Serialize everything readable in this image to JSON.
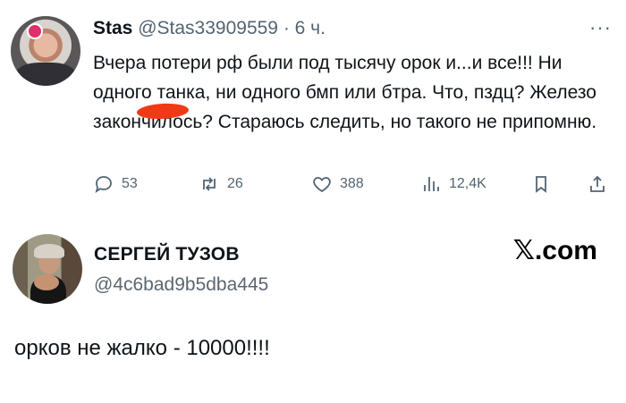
{
  "tweet": {
    "author_name": "Stas",
    "handle": "@Stas33909559",
    "separator": " · ",
    "time": "6 ч.",
    "more_icon": "more-dots-icon",
    "text": "Вчера потери рф были под тысячу орок и...и все!!! Ни одного танка, ни одного бмп или бтра. Что, пздц? Железо закончилось? Стараюсь следить, но такого не припомню.",
    "actions": {
      "replies": "53",
      "reposts": "26",
      "likes": "388",
      "views": "12,4K"
    },
    "colors": {
      "text": "#0f1419",
      "muted": "#536471",
      "redaction": "#f03a17"
    }
  },
  "profile": {
    "name": "СЕРГЕЙ ТУЗОВ",
    "handle": "@4c6bad9b5dba445",
    "brand": "𝕏.com"
  },
  "comment": "орков не жалко - 10000!!!!"
}
